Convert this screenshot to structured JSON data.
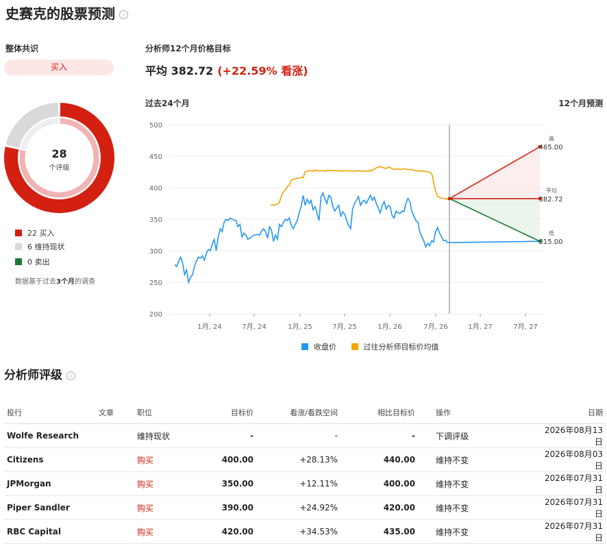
{
  "header": {
    "title": "史赛克的股票预测",
    "info_icon": "info-icon"
  },
  "consensus": {
    "label": "整体共识",
    "rating": "买入",
    "total": "28",
    "total_sub": "个评级",
    "counts": [
      {
        "label": "22 买入",
        "count": 22,
        "color": "#d32011"
      },
      {
        "label": "6 维持现状",
        "count": 6,
        "color": "#d9d9d9"
      },
      {
        "label": "0 卖出",
        "count": 0,
        "color": "#1a7a33"
      }
    ],
    "basis_prefix": "数据基于过去",
    "basis_bold": "3个月",
    "basis_suffix": "的调查"
  },
  "target": {
    "label": "分析师12个月价格目标",
    "avg_text": "平均 382.72",
    "upside_text": "(+22.59% 看涨)",
    "past_label": "过去24个月",
    "forecast_label": "12个月预测"
  },
  "chart_data": {
    "type": "line",
    "ylim": [
      200,
      500
    ],
    "yticks": [
      "500",
      "450",
      "400",
      "350",
      "300",
      "250",
      "200"
    ],
    "xticks": [
      "1月, 24",
      "7月, 24",
      "1月, 25",
      "7月, 25",
      "1月, 26",
      "7月, 26",
      "1月, 27",
      "7月, 27"
    ],
    "colors": {
      "close": "#2196f3",
      "avg_target": "#f5a300",
      "high": "#d32011",
      "avg": "#d32011",
      "low": "#1a7a33"
    },
    "series": [
      {
        "name": "收盘价",
        "values": [
          278,
          275,
          283,
          290,
          281,
          262,
          270,
          250,
          258,
          262,
          275,
          283,
          290,
          288,
          292,
          285,
          296,
          302,
          300,
          310,
          318,
          300,
          322,
          335,
          330,
          345,
          350,
          348,
          352,
          350,
          349,
          348,
          338,
          342,
          322,
          328,
          325,
          318,
          320,
          322,
          325,
          325,
          326,
          325,
          332,
          335,
          330,
          320,
          338,
          332,
          315,
          325,
          318,
          342,
          338,
          345,
          350,
          348,
          352,
          340,
          335,
          342,
          348,
          360,
          370,
          388,
          372,
          382,
          375,
          380,
          365,
          370,
          360,
          348,
          385,
          392,
          382,
          375,
          388,
          385,
          370,
          363,
          368,
          372,
          355,
          362,
          358,
          348,
          340,
          335,
          366,
          375,
          380,
          386,
          372,
          378,
          380,
          375,
          382,
          388,
          380,
          385,
          375,
          368,
          360,
          372,
          378,
          366,
          372,
          370,
          356,
          352,
          363,
          360,
          359,
          363,
          362,
          375,
          383,
          378,
          362,
          355,
          348,
          346,
          330,
          323,
          316,
          306,
          312,
          308,
          316,
          314,
          330,
          337,
          328,
          322,
          316,
          317,
          313,
          313
        ]
      },
      {
        "name": "过往分析师目标价均值",
        "values": [
          373,
          373,
          372,
          373,
          374,
          376,
          385,
          392,
          395,
          398,
          403,
          404,
          412,
          413,
          414,
          415,
          415,
          416,
          416,
          416,
          425,
          426,
          427,
          427,
          427,
          426,
          428,
          427,
          427,
          427,
          427,
          427,
          426,
          428,
          427,
          428,
          427,
          427,
          427,
          427,
          427,
          427,
          426,
          427,
          427,
          427,
          426,
          427,
          426,
          426,
          427,
          427,
          426,
          427,
          426,
          426,
          427,
          426,
          428,
          427,
          429,
          431,
          432,
          433,
          433,
          432,
          432,
          430,
          432,
          433,
          431,
          430,
          429,
          429,
          430,
          429,
          429,
          430,
          430,
          429,
          429,
          428,
          429,
          428,
          427,
          427,
          427,
          426,
          427,
          426,
          426,
          425,
          425,
          424,
          420,
          405,
          395,
          387,
          385,
          384,
          383,
          383,
          382,
          382,
          382
        ]
      }
    ],
    "forecast": {
      "start": 382.72,
      "high": {
        "label": "高",
        "value": "465.00"
      },
      "avg": {
        "label": "平均",
        "value": "382.72"
      },
      "low": {
        "label": "低",
        "value": "315.00"
      }
    }
  },
  "table": {
    "section_title": "分析师评级",
    "headers": [
      "投行",
      "文章",
      "职位",
      "目标价",
      "看涨/看跌空间",
      "相比目标价",
      "操作",
      "日期"
    ],
    "rows": [
      {
        "firm": "Wolfe Research",
        "article": "",
        "position": "维持现状",
        "target": "-",
        "upside": "-",
        "prev": "-",
        "action": "下调评级",
        "date": "2026年08月13日",
        "pos_color": "#222"
      },
      {
        "firm": "Citizens",
        "article": "",
        "position": "购买",
        "target": "400.00",
        "upside": "+28.13%",
        "prev": "440.00",
        "action": "维持不变",
        "date": "2026年08月03日",
        "pos_color": "#d32011"
      },
      {
        "firm": "JPMorgan",
        "article": "",
        "position": "购买",
        "target": "350.00",
        "upside": "+12.11%",
        "prev": "400.00",
        "action": "维持不变",
        "date": "2026年07月31日",
        "pos_color": "#d32011"
      },
      {
        "firm": "Piper Sandler",
        "article": "",
        "position": "购买",
        "target": "390.00",
        "upside": "+24.92%",
        "prev": "420.00",
        "action": "维持不变",
        "date": "2026年07月31日",
        "pos_color": "#d32011"
      },
      {
        "firm": "RBC Capital",
        "article": "",
        "position": "购买",
        "target": "420.00",
        "upside": "+34.53%",
        "prev": "435.00",
        "action": "维持不变",
        "date": "2026年07月31日",
        "pos_color": "#d32011"
      }
    ]
  }
}
